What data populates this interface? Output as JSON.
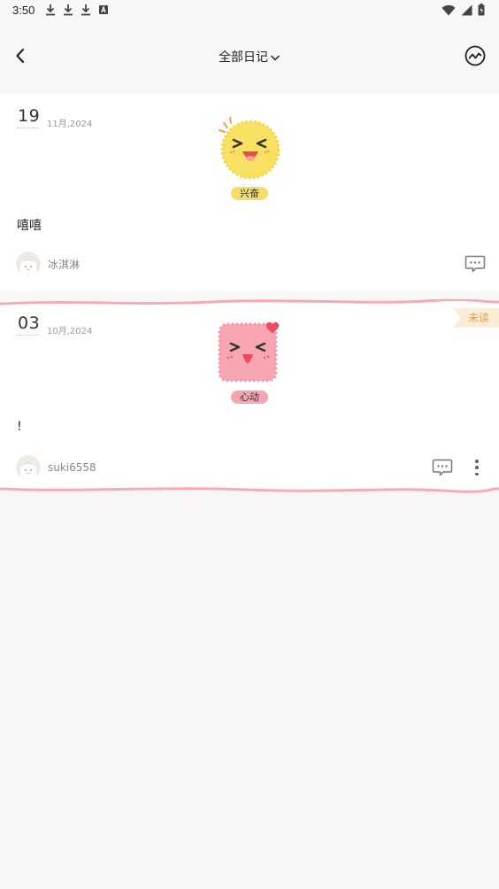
{
  "status_bar": {
    "time": "3:50",
    "left_icons": [
      "download-icon",
      "download-icon",
      "download-icon",
      "a-box-icon"
    ],
    "right_icons": [
      "wifi-icon",
      "signal-icon",
      "battery-icon"
    ]
  },
  "header": {
    "title": "全部日记",
    "back_icon": "chevron-left-icon",
    "dropdown_icon": "chevron-down-icon",
    "stats_icon": "trend-circle-icon"
  },
  "entries": [
    {
      "day": "19",
      "month_year": "11月,2024",
      "mood": {
        "label": "兴奋",
        "icon": "excited-face-icon",
        "color": "#f5dd6a"
      },
      "text": "嘻嘻",
      "author": "冰淇淋",
      "unread": false,
      "comment_icon": "comment-icon"
    },
    {
      "day": "03",
      "month_year": "10月,2024",
      "mood": {
        "label": "心动",
        "icon": "heart-flutter-face-icon",
        "color": "#f4a6b3"
      },
      "text": "!",
      "author": "suki6558",
      "unread": true,
      "unread_label": "未读",
      "comment_icon": "comment-icon",
      "more_icon": "more-vertical-icon"
    }
  ],
  "colors": {
    "background": "#f8f7f5",
    "card": "#ffffff",
    "highlight_border": "#f7a9b4",
    "unread_badge_bg": "#fbecd6",
    "unread_badge_text": "#e3a250"
  }
}
